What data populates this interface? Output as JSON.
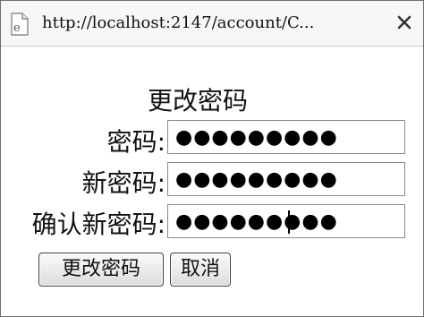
{
  "window": {
    "url": "http://localhost:2147/account/C...",
    "page_icon": "page-e-icon",
    "close_icon": "close-icon"
  },
  "form": {
    "title": "更改密码",
    "fields": [
      {
        "label": "密码:",
        "value_masked": "●●●●●●●●●"
      },
      {
        "label": "新密码:",
        "value_masked": "●●●●●●●●●"
      },
      {
        "label": "确认新密码:",
        "value_masked": "●●●●●●●●●"
      }
    ],
    "buttons": {
      "submit_label": "更改密码",
      "cancel_label": "取消"
    }
  }
}
